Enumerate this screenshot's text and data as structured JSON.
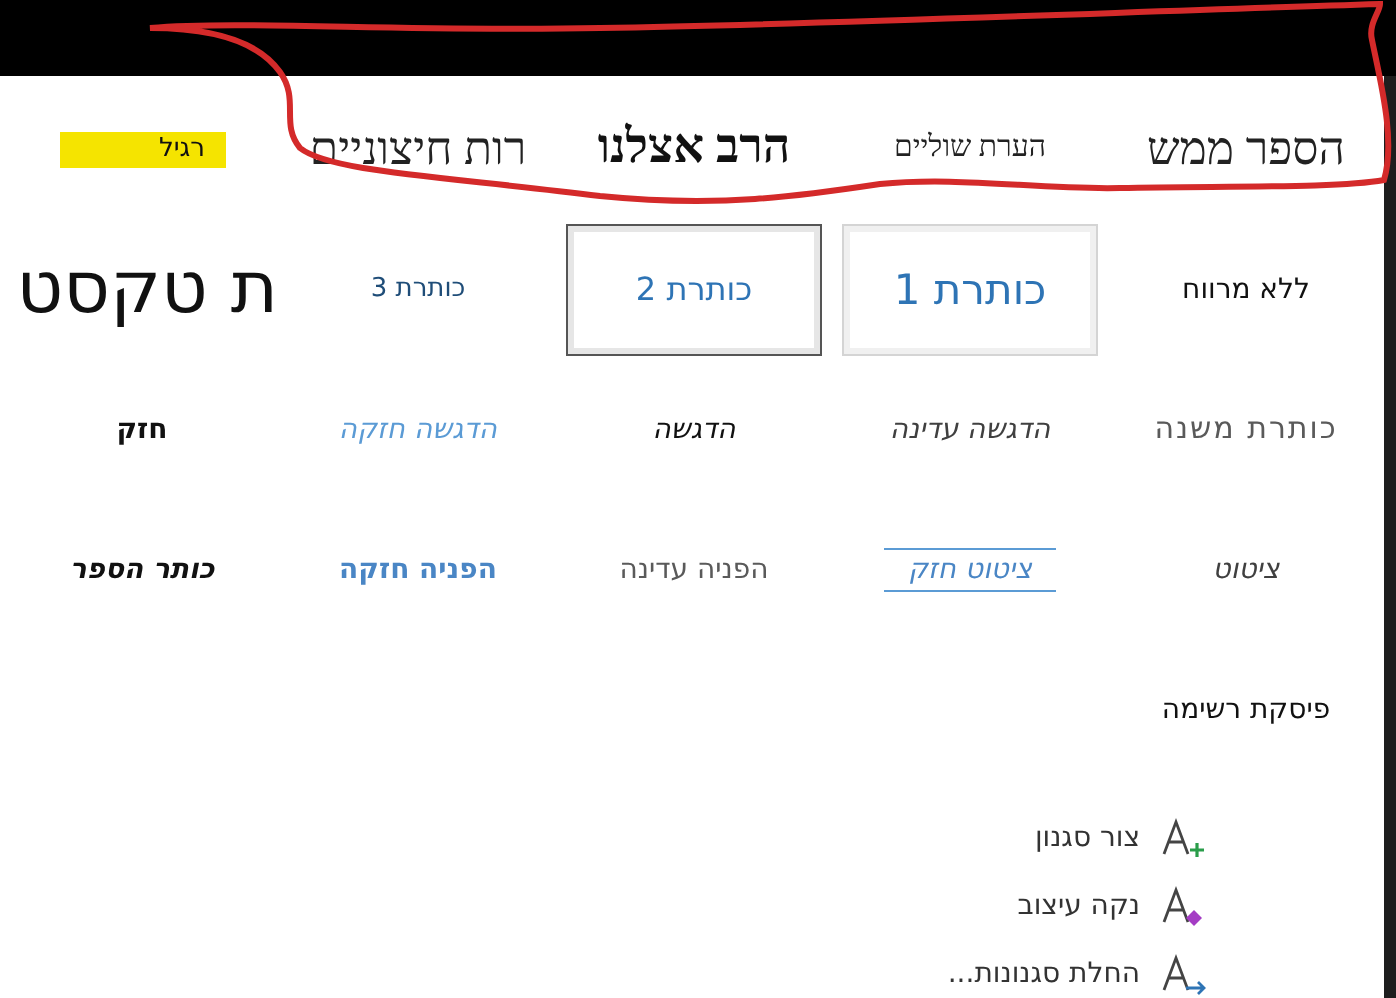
{
  "styles": [
    {
      "label": "הספר ממש",
      "kind": "body_serif",
      "selected": false,
      "hovered": false,
      "highlighted": false
    },
    {
      "label": "הערת שוליים",
      "kind": "footnote",
      "selected": false,
      "hovered": false,
      "highlighted": false
    },
    {
      "label": "הרב אצלנו",
      "kind": "bold_serif",
      "selected": false,
      "hovered": false,
      "highlighted": false
    },
    {
      "label": "רות חיצוניים",
      "kind": "body_serif",
      "selected": false,
      "hovered": false,
      "highlighted": false
    },
    {
      "label": "רגיל",
      "kind": "normal",
      "selected": false,
      "hovered": false,
      "highlighted": true
    },
    {
      "label": "ללא מרווח",
      "kind": "no_spacing",
      "selected": false,
      "hovered": false,
      "highlighted": false
    },
    {
      "label": "כותרת 1",
      "kind": "heading1",
      "selected": false,
      "hovered": true,
      "highlighted": false
    },
    {
      "label": "כותרת 2",
      "kind": "heading2",
      "selected": true,
      "hovered": false,
      "highlighted": false
    },
    {
      "label": "כותרת 3",
      "kind": "heading3",
      "selected": false,
      "hovered": false,
      "highlighted": false
    },
    {
      "label": "ת טקסט",
      "kind": "title",
      "selected": false,
      "hovered": false,
      "highlighted": false
    },
    {
      "label": "כותרת משנה",
      "kind": "subtitle",
      "selected": false,
      "hovered": false,
      "highlighted": false
    },
    {
      "label": "הדגשה עדינה",
      "kind": "subtle_emphasis",
      "selected": false,
      "hovered": false,
      "highlighted": false
    },
    {
      "label": "הדגשה",
      "kind": "emphasis",
      "selected": false,
      "hovered": false,
      "highlighted": false
    },
    {
      "label": "הדגשה חזקה",
      "kind": "intense_emphasis",
      "selected": false,
      "hovered": false,
      "highlighted": false
    },
    {
      "label": "חזק",
      "kind": "strong",
      "selected": false,
      "hovered": false,
      "highlighted": false
    },
    {
      "label": "ציטוט",
      "kind": "quote",
      "selected": false,
      "hovered": false,
      "highlighted": false
    },
    {
      "label": "ציטוט חזק",
      "kind": "intense_quote",
      "selected": false,
      "hovered": false,
      "highlighted": false
    },
    {
      "label": "הפניה עדינה",
      "kind": "subtle_reference",
      "selected": false,
      "hovered": false,
      "highlighted": false
    },
    {
      "label": "הפניה חזקה",
      "kind": "intense_reference",
      "selected": false,
      "hovered": false,
      "highlighted": false
    },
    {
      "label": "כותר הספר",
      "kind": "book_title",
      "selected": false,
      "hovered": false,
      "highlighted": false
    },
    {
      "label": "פיסקת רשימה",
      "kind": "list_paragraph",
      "selected": false,
      "hovered": false,
      "highlighted": false
    }
  ],
  "commands": [
    {
      "label": "צור סגנון",
      "kind": "new_style"
    },
    {
      "label": "נקה עיצוב",
      "kind": "clear_formatting"
    },
    {
      "label": "החלת סגנונות...",
      "kind": "apply_styles"
    }
  ]
}
